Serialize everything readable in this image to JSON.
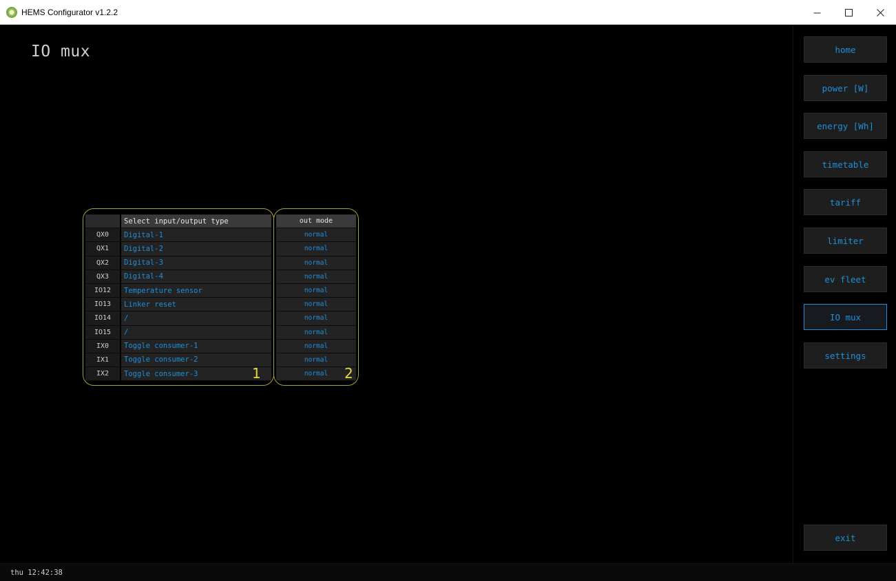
{
  "window": {
    "title": "HEMS Configurator v1.2.2"
  },
  "page": {
    "title": "IO mux"
  },
  "io_table": {
    "header": "Select input/output type",
    "rows": [
      {
        "id": "QX0",
        "type": "Digital-1"
      },
      {
        "id": "QX1",
        "type": "Digital-2"
      },
      {
        "id": "QX2",
        "type": "Digital-3"
      },
      {
        "id": "QX3",
        "type": "Digital-4"
      },
      {
        "id": "IO12",
        "type": "Temperature sensor"
      },
      {
        "id": "IO13",
        "type": "Linker reset"
      },
      {
        "id": "IO14",
        "type": "/"
      },
      {
        "id": "IO15",
        "type": "/"
      },
      {
        "id": "IX0",
        "type": "Toggle consumer-1"
      },
      {
        "id": "IX1",
        "type": "Toggle consumer-2"
      },
      {
        "id": "IX2",
        "type": "Toggle consumer-3"
      }
    ],
    "marker": "1"
  },
  "mode_table": {
    "header": "out mode",
    "values": [
      "normal",
      "normal",
      "normal",
      "normal",
      "normal",
      "normal",
      "normal",
      "normal",
      "normal",
      "normal",
      "normal"
    ],
    "marker": "2"
  },
  "sidebar": {
    "items": [
      {
        "label": "home"
      },
      {
        "label": "power [W]"
      },
      {
        "label": "energy [Wh]"
      },
      {
        "label": "timetable"
      },
      {
        "label": "tariff"
      },
      {
        "label": "limiter"
      },
      {
        "label": "ev fleet"
      },
      {
        "label": "IO mux",
        "active": true
      },
      {
        "label": "settings"
      }
    ],
    "exit_label": "exit"
  },
  "status": {
    "time": "thu 12:42:38"
  },
  "colors": {
    "accent": "#1f8fd8",
    "highlight": "#a5a23f",
    "marker": "#e7dd3a"
  }
}
